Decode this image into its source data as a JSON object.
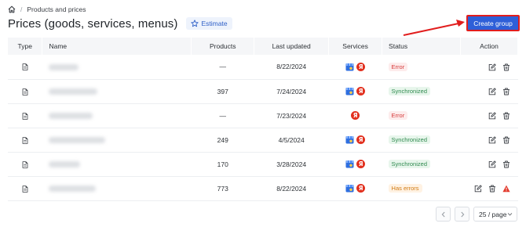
{
  "breadcrumb": {
    "current": "Products and prices"
  },
  "header": {
    "title": "Prices (goods, services, menus)",
    "estimate_label": "Estimate",
    "create_label": "Create group"
  },
  "table": {
    "columns": {
      "type": "Type",
      "name": "Name",
      "products": "Products",
      "updated": "Last updated",
      "services": "Services",
      "status": "Status",
      "action": "Action"
    },
    "rows": [
      {
        "products": "—",
        "updated": "8/22/2024",
        "services": [
          "google",
          "yandex"
        ],
        "status": "Error",
        "status_kind": "error",
        "warning": false
      },
      {
        "products": "397",
        "updated": "7/24/2024",
        "services": [
          "google",
          "yandex"
        ],
        "status": "Synchronized",
        "status_kind": "sync",
        "warning": false
      },
      {
        "products": "—",
        "updated": "7/23/2024",
        "services": [
          "yandex"
        ],
        "status": "Error",
        "status_kind": "error",
        "warning": false
      },
      {
        "products": "249",
        "updated": "4/5/2024",
        "services": [
          "google",
          "yandex"
        ],
        "status": "Synchronized",
        "status_kind": "sync",
        "warning": false
      },
      {
        "products": "170",
        "updated": "3/28/2024",
        "services": [
          "google",
          "yandex"
        ],
        "status": "Synchronized",
        "status_kind": "sync",
        "warning": false
      },
      {
        "products": "773",
        "updated": "8/22/2024",
        "services": [
          "google",
          "yandex"
        ],
        "status": "Has errors",
        "status_kind": "warn",
        "warning": true
      }
    ]
  },
  "icons": {
    "yandex_glyph": "Я"
  },
  "pagination": {
    "per_page": "25 / page"
  },
  "colors": {
    "primary": "#2e5fd8",
    "annotation": "#e11d1d"
  }
}
